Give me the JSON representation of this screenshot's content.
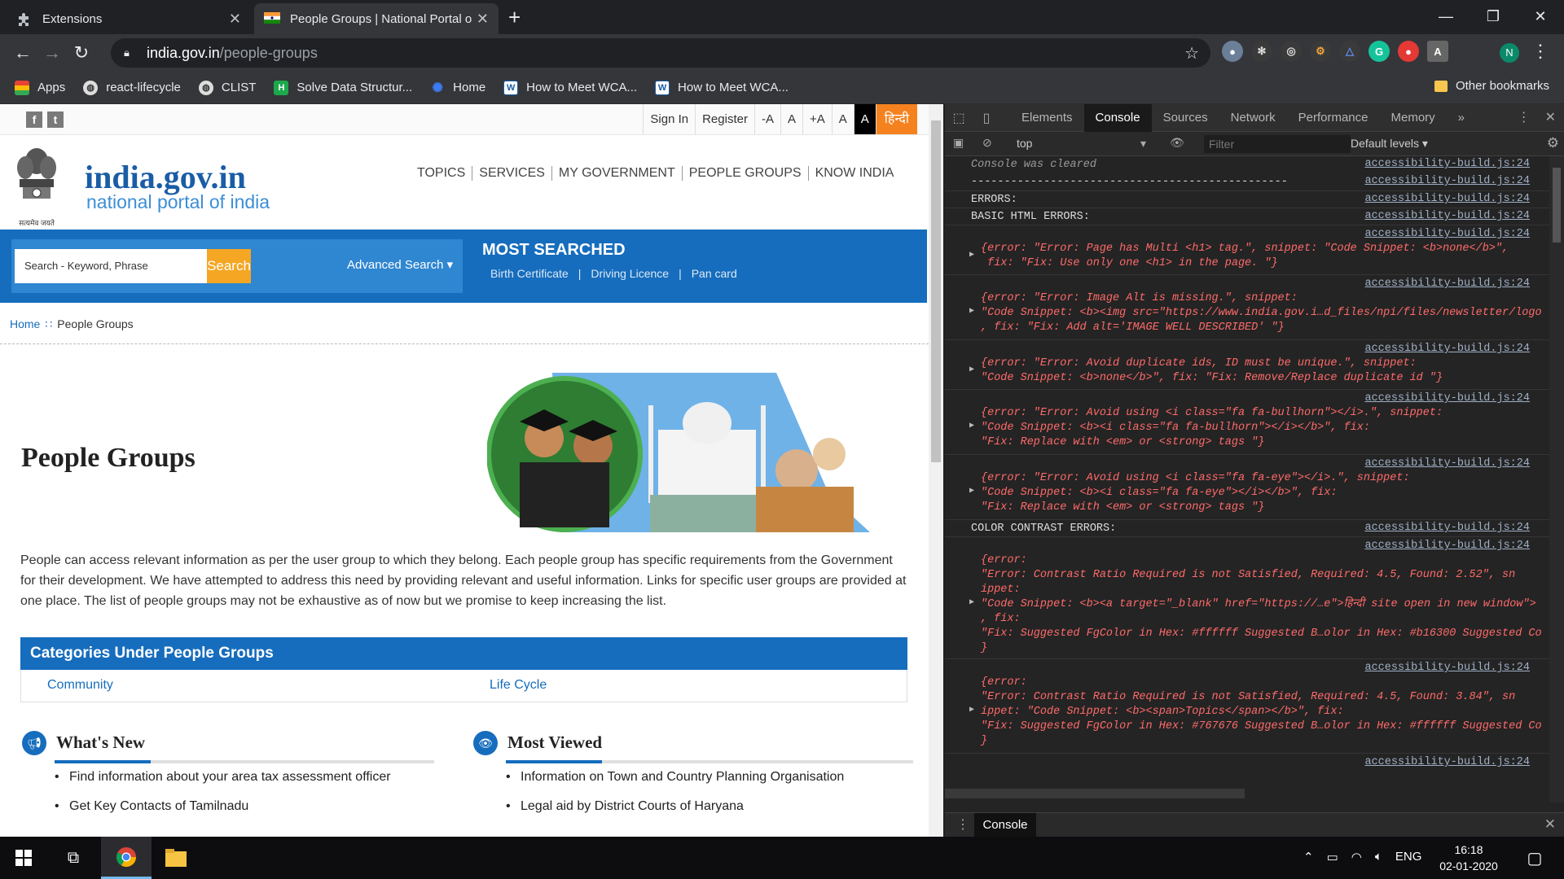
{
  "browser": {
    "tabs": [
      {
        "label": "Extensions",
        "active": false,
        "icon": "puzzle-icon"
      },
      {
        "label": "People Groups | National Portal of",
        "active": true,
        "icon": "india-flag-icon"
      }
    ],
    "url_host": "india.gov.in",
    "url_path": "/people-groups",
    "bookmarks": [
      {
        "label": "Apps",
        "icon": "apps-grid-icon"
      },
      {
        "label": "react-lifecycle",
        "icon": "globe-icon"
      },
      {
        "label": "CLIST",
        "icon": "globe-icon"
      },
      {
        "label": "Solve Data Structur...",
        "icon": "hackerrank-icon"
      },
      {
        "label": "Home",
        "icon": "gear-icon"
      },
      {
        "label": "How to Meet WCA...",
        "icon": "w3-icon"
      },
      {
        "label": "How to Meet WCA...",
        "icon": "w3-icon"
      }
    ],
    "other_bookmarks": "Other bookmarks",
    "avatar_letter": "N"
  },
  "site": {
    "social": [
      "f",
      "t"
    ],
    "top_links": [
      "Sign In",
      "Register",
      "-A",
      "A",
      "+A",
      "A",
      "A",
      "हिन्दी"
    ],
    "logo_title": "india.gov.in",
    "logo_subtitle": "national portal of india",
    "emblem_text": "सत्यमेव जयते",
    "main_nav": [
      "TOPICS",
      "SERVICES",
      "MY GOVERNMENT",
      "PEOPLE GROUPS",
      "KNOW INDIA"
    ],
    "search": {
      "placeholder": "Search - Keyword, Phrase",
      "button": "Search",
      "advanced": "Advanced Search ▾"
    },
    "most_searched": {
      "title": "MOST SEARCHED",
      "links": [
        "Birth Certificate",
        "Driving Licence",
        "Pan card"
      ]
    },
    "breadcrumb": {
      "home": "Home",
      "current": "People Groups"
    },
    "page_title": "People Groups",
    "intro": "People can access relevant information as per the user group to which they belong. Each people group has specific requirements from the Government for their development. We have attempted to address this need by providing relevant and useful information. Links for specific user groups are provided at one place. The list of people groups may not be exhaustive as of now but we promise to keep increasing the list.",
    "categories": {
      "title": "Categories Under People Groups",
      "items": [
        "Community",
        "Life Cycle"
      ]
    },
    "whats_new": {
      "title": "What's New",
      "items": [
        "Find information about your area tax assessment officer",
        "Get Key Contacts of Tamilnadu"
      ]
    },
    "most_viewed": {
      "title": "Most Viewed",
      "items": [
        "Information on Town and Country Planning Organisation",
        "Legal aid by District Courts of Haryana"
      ]
    }
  },
  "devtools": {
    "tabs": [
      "Elements",
      "Console",
      "Sources",
      "Network",
      "Performance",
      "Memory"
    ],
    "context": "top",
    "filter_placeholder": "Filter",
    "levels": "Default levels ▾",
    "bottom_tab": "Console",
    "source": "accessibility-build.js:24",
    "lines": [
      "Console was cleared",
      "------------------------------------------------",
      "ERRORS:",
      "BASIC HTML ERRORS:"
    ],
    "obj1": [
      "{error: \"Error: Page has Multi <h1> tag.\", snippet: \"Code Snippet: <b>none</b>\",",
      " fix: \"Fix: Use only one <h1> in the page. \"}"
    ],
    "obj2": [
      "{error: \"Error: Image Alt is missing.\", snippet:",
      "\"Code Snippet: <b><img src=\"https://www.india.gov.i…d_files/npi/files/newsletter/logo",
      ", fix: \"Fix: Add alt='IMAGE WELL DESCRIBED' \"}"
    ],
    "obj3": [
      "{error: \"Error: Avoid duplicate ids, ID must be unique.\", snippet:",
      "\"Code Snippet: <b>none</b>\", fix: \"Fix: Remove/Replace duplicate id \"}"
    ],
    "obj4": [
      "{error: \"Error: Avoid using <i class=\"fa fa-bullhorn\"></i>.\", snippet:",
      "\"Code Snippet: <b><i class=\"fa fa-bullhorn\"></i></b>\", fix:",
      "\"Fix: Replace with <em> or <strong> tags \"}"
    ],
    "obj5": [
      "{error: \"Error: Avoid using <i class=\"fa fa-eye\"></i>.\", snippet:",
      "\"Code Snippet: <b><i class=\"fa fa-eye\"></i></b>\", fix:",
      "\"Fix: Replace with <em> or <strong> tags \"}"
    ],
    "color_header": "COLOR CONTRAST ERRORS:",
    "obj6": [
      "{error:",
      "\"Error: Contrast Ratio Required is not Satisfied, Required: 4.5, Found: 2.52\", sn",
      "ippet:",
      "\"Code Snippet: <b><a target=\"_blank\" href=\"https://…e\">हिन्दी site open in new window\">",
      ", fix:",
      "\"Fix: Suggested FgColor in Hex: #ffffff Suggested B…olor in Hex: #b16300 Suggested Co",
      "}"
    ],
    "obj7": [
      "{error:",
      "\"Error: Contrast Ratio Required is not Satisfied, Required: 4.5, Found: 3.84\", sn",
      "ippet: \"Code Snippet: <b><span>Topics</span></b>\", fix:",
      "\"Fix: Suggested FgColor in Hex: #767676 Suggested B…olor in Hex: #ffffff Suggested Co",
      "}"
    ]
  },
  "taskbar": {
    "lang": "ENG",
    "time": "16:18",
    "date": "02-01-2020"
  }
}
